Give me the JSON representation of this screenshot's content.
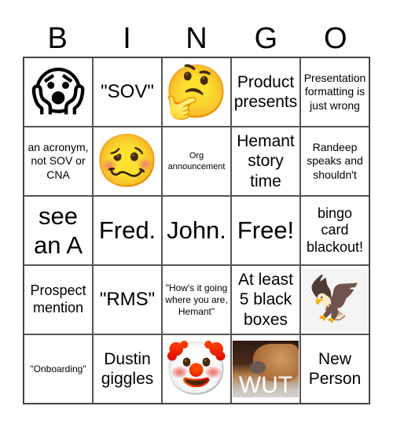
{
  "header": [
    "B",
    "I",
    "N",
    "G",
    "O"
  ],
  "cells": [
    {
      "type": "emoji",
      "icon": "face-screaming-in-fear-icon",
      "glyph": "😱"
    },
    {
      "type": "text",
      "text": "\"SOV\"",
      "size": "t-l"
    },
    {
      "type": "emoji",
      "icon": "thinking-face-icon",
      "glyph": "🤔"
    },
    {
      "type": "text",
      "text": "Product presents",
      "size": "t-m"
    },
    {
      "type": "text",
      "text": "Presentation formatting is just wrong",
      "size": "t-xs"
    },
    {
      "type": "text",
      "text": "an acronym, not SOV or CNA",
      "size": "t-xs"
    },
    {
      "type": "emoji",
      "icon": "woozy-face-icon",
      "glyph": "🥴"
    },
    {
      "type": "text",
      "text": "Org announcement",
      "size": "t-tiny"
    },
    {
      "type": "text",
      "text": "Hemant story time",
      "size": "t-m"
    },
    {
      "type": "text",
      "text": "Randeep speaks and shouldn't",
      "size": "t-xs"
    },
    {
      "type": "text",
      "text": "see an A",
      "size": "t-xl"
    },
    {
      "type": "text",
      "text": "Fred.",
      "size": "t-xl"
    },
    {
      "type": "text",
      "text": "John.",
      "size": "t-xl"
    },
    {
      "type": "text",
      "text": "Free!",
      "size": "t-xl"
    },
    {
      "type": "text",
      "text": "bingo card blackout!",
      "size": "t-ms"
    },
    {
      "type": "text",
      "text": "Prospect mention",
      "size": "t-ms"
    },
    {
      "type": "text",
      "text": "\"RMS\"",
      "size": "t-l"
    },
    {
      "type": "text",
      "text": "\"How's it going where you are, Hemant\"",
      "size": "t-xxs"
    },
    {
      "type": "text",
      "text": "At least 5 black boxes",
      "size": "t-m"
    },
    {
      "type": "image",
      "icon": "bald-eagle-image",
      "glyph": "🦅"
    },
    {
      "type": "text",
      "text": "\"Onboarding\"",
      "size": "t-xxs"
    },
    {
      "type": "text",
      "text": "Dustin giggles",
      "size": "t-m"
    },
    {
      "type": "emoji",
      "icon": "clown-face-icon",
      "glyph": "🤡"
    },
    {
      "type": "image-dog",
      "icon": "dog-wut-meme-image",
      "caption": "WUT"
    },
    {
      "type": "text",
      "text": "New Person",
      "size": "t-m"
    }
  ]
}
